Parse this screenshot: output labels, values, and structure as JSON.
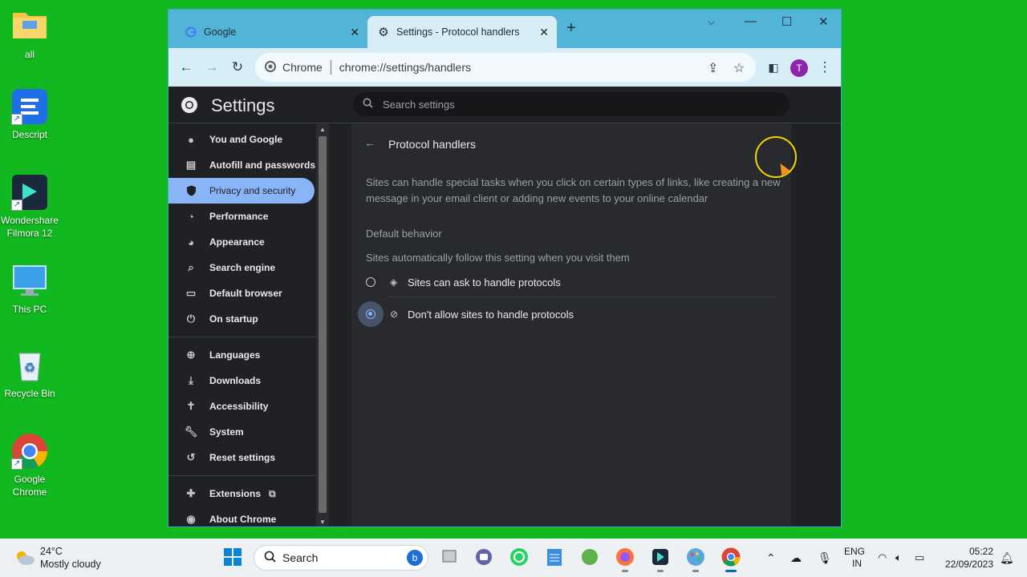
{
  "desktop": {
    "icons": [
      {
        "label": "all"
      },
      {
        "label": "Descript"
      },
      {
        "label": "Wondershare Filmora 12"
      },
      {
        "label": "This PC"
      },
      {
        "label": "Recycle Bin"
      },
      {
        "label": "Google Chrome"
      }
    ]
  },
  "browser": {
    "tabs": [
      {
        "title": "Google"
      },
      {
        "title": "Settings - Protocol handlers"
      }
    ],
    "omnibox": {
      "site_label": "Chrome",
      "url": "chrome://settings/handlers"
    },
    "avatar_initial": "T",
    "avatar_color": "#8e24aa",
    "accent": "#8ab4f8"
  },
  "settings": {
    "title": "Settings",
    "search_placeholder": "Search settings",
    "nav": [
      {
        "label": "You and Google",
        "icon": "person-icon"
      },
      {
        "label": "Autofill and passwords",
        "icon": "clipboard-icon"
      },
      {
        "label": "Privacy and security",
        "icon": "shield-icon",
        "active": true
      },
      {
        "label": "Performance",
        "icon": "speedometer-icon"
      },
      {
        "label": "Appearance",
        "icon": "palette-icon"
      },
      {
        "label": "Search engine",
        "icon": "search-icon"
      },
      {
        "label": "Default browser",
        "icon": "browser-icon"
      },
      {
        "label": "On startup",
        "icon": "power-icon"
      },
      {
        "label": "Languages",
        "icon": "globe-icon"
      },
      {
        "label": "Downloads",
        "icon": "download-icon"
      },
      {
        "label": "Accessibility",
        "icon": "accessibility-icon"
      },
      {
        "label": "System",
        "icon": "wrench-icon"
      },
      {
        "label": "Reset settings",
        "icon": "reset-icon"
      },
      {
        "label": "Extensions",
        "icon": "puzzle-icon"
      },
      {
        "label": "About Chrome",
        "icon": "chrome-icon"
      }
    ],
    "page": {
      "title": "Protocol handlers",
      "description": "Sites can handle special tasks when you click on certain types of links, like creating a new message in your email client or adding new events to your online calendar",
      "section_title": "Default behavior",
      "section_subtitle": "Sites automatically follow this setting when you visit them",
      "options": [
        {
          "label": "Sites can ask to handle protocols",
          "checked": false
        },
        {
          "label": "Don't allow sites to handle protocols",
          "checked": true
        }
      ]
    }
  },
  "taskbar": {
    "weather": {
      "temp": "24°C",
      "condition": "Mostly cloudy"
    },
    "search_label": "Search",
    "language": {
      "line1": "ENG",
      "line2": "IN"
    },
    "clock": {
      "time": "05:22",
      "date": "22/09/2023"
    }
  }
}
